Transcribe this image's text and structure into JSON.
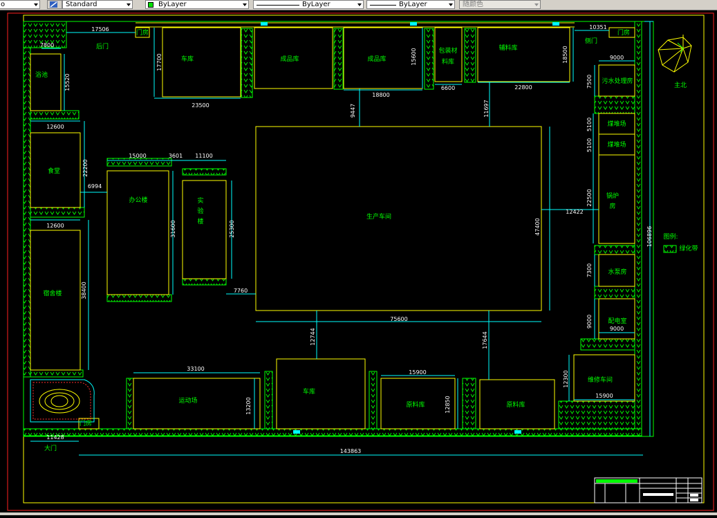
{
  "toolbar": {
    "text_style": "Standard",
    "color": "ByLayer",
    "linetype": "ByLayer",
    "lineweight": "ByLayer",
    "plot_style": "随颜色"
  },
  "colors": {
    "frame": "#ff2020",
    "wall": "#ffff00",
    "dim": "#00ffff",
    "green": "#00ff00",
    "label": "#00ff00",
    "background": "#000000"
  },
  "plan": {
    "rooms": {
      "garage_top": "车库",
      "finished_store_1": "成品库",
      "finished_store_2": "成品库",
      "packaging_store": "包装材\n料库",
      "aux_store": "辅料库",
      "wastewater_room": "污水处理房",
      "coal_store_1": "煤堆场",
      "coal_store_2": "煤堆场",
      "boiler_room": "锅炉\n房",
      "pump_room": "水泵房",
      "power_room": "配电室",
      "repair_shop": "维修车间",
      "bathroom": "浴池",
      "canteen": "食堂",
      "dormitory": "宿舍楼",
      "office": "办公楼",
      "lab": "实\n验\n楼",
      "production": "生产车间",
      "sports_field": "运动场",
      "garage_bottom": "车库",
      "raw_store_1": "原料库",
      "raw_store_2": "原料库",
      "guard_left": "门房",
      "guard_top": "门房",
      "guard_right": "门房"
    },
    "gates": {
      "back_gate": "后门",
      "side_gate": "侧门",
      "main_gate": "大门"
    },
    "north": "主北",
    "legend": {
      "title": "图例:",
      "green_belt": "绿化带"
    },
    "dims": {
      "d17506": "17506",
      "d10351": "10351",
      "d7800": "7800",
      "d15520": "15520",
      "d12600a": "12600",
      "d22200": "22200",
      "d6994": "6994",
      "d12600b": "12600",
      "d38400": "38400",
      "d15000": "15000",
      "d3601": "3601",
      "d11100": "11100",
      "d31600": "31600",
      "d25300": "25300",
      "d7760": "7760",
      "d17700": "17700",
      "d23500": "23500",
      "d15600": "15600",
      "d18800": "18800",
      "d6600": "6600",
      "d22800": "22800",
      "d18500": "18500",
      "d9447": "9447",
      "d11697": "11697",
      "d9000a": "9000",
      "d7500": "7500",
      "d5100a": "5100",
      "d5100b": "5100",
      "d22500": "22500",
      "d12422": "12422",
      "d47400": "47400",
      "d75600": "75600",
      "d7300": "7300",
      "d9000b": "9000",
      "d9000c": "9000",
      "d12300": "12300",
      "d15900a": "15900",
      "d33100": "33100",
      "d13200": "13200",
      "d12744": "12744",
      "d17644": "17644",
      "d15900b": "15900",
      "d12850": "12850",
      "d11428": "11428",
      "d143863": "143863",
      "d106896": "106896"
    }
  }
}
